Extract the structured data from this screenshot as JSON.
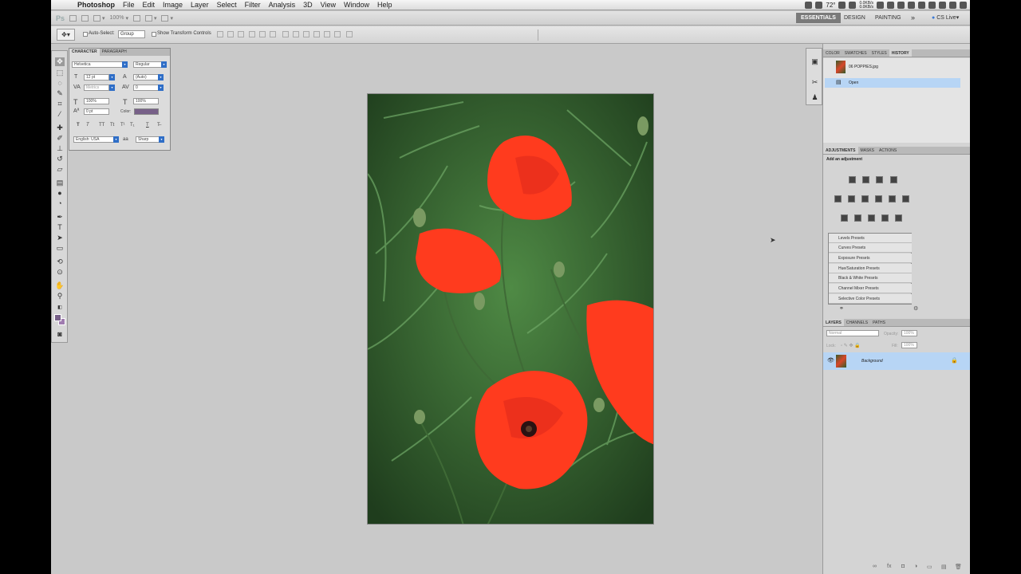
{
  "menubar": {
    "app_name": "Photoshop",
    "items": [
      "File",
      "Edit",
      "Image",
      "Layer",
      "Select",
      "Filter",
      "Analysis",
      "3D",
      "View",
      "Window",
      "Help"
    ],
    "tray": {
      "temperature": "72°",
      "net_up": "0.0KB/s",
      "net_down": "0.0KB/s"
    }
  },
  "appbar": {
    "zoom": "100%",
    "workspaces": [
      "ESSENTIALS",
      "DESIGN",
      "PAINTING"
    ],
    "more": "»",
    "cs_live": "CS Live"
  },
  "options": {
    "auto_select_label": "Auto-Select:",
    "auto_select_value": "Group",
    "transform_label": "Show Transform Controls"
  },
  "character_panel": {
    "tabs": [
      "CHARACTER",
      "PARAGRAPH"
    ],
    "font_family": "Helvetica",
    "font_style": "Regular",
    "size": "12 pt",
    "leading": "(Auto)",
    "kerning": "Metrics",
    "tracking": "0",
    "vscale": "100%",
    "hscale": "100%",
    "baseline": "0 pt",
    "color_label": "Color:",
    "styles": [
      "T",
      "T",
      "TT",
      "Tt",
      "T¹",
      "T₁",
      "T",
      "T̶"
    ],
    "language": "English: USA",
    "aa_label": "aa",
    "antialias": "Sharp"
  },
  "history_panel": {
    "tabs": [
      "COLOR",
      "SWATCHES",
      "STYLES",
      "HISTORY"
    ],
    "snapshot": "06 POPPIES.jpg",
    "state": "Open"
  },
  "adjustments_panel": {
    "tabs": [
      "ADJUSTMENTS",
      "MASKS",
      "ACTIONS"
    ],
    "title": "Add an adjustment",
    "presets": [
      "Levels Presets",
      "Curves Presets",
      "Exposure Presets",
      "Hue/Saturation Presets",
      "Black & White Presets",
      "Channel Mixer Presets",
      "Selective Color Presets"
    ]
  },
  "layers_panel": {
    "tabs": [
      "LAYERS",
      "CHANNELS",
      "PATHS"
    ],
    "blend_mode": "Normal",
    "opacity_label": "Opacity:",
    "opacity": "100%",
    "lock_label": "Lock:",
    "fill_label": "Fill:",
    "fill": "100%",
    "layer_name": "Background"
  },
  "colors": {
    "foreground": "#776088",
    "background": "#a07cb0",
    "workspace": "#c9c9c9",
    "selection": "#b7d5f5"
  }
}
